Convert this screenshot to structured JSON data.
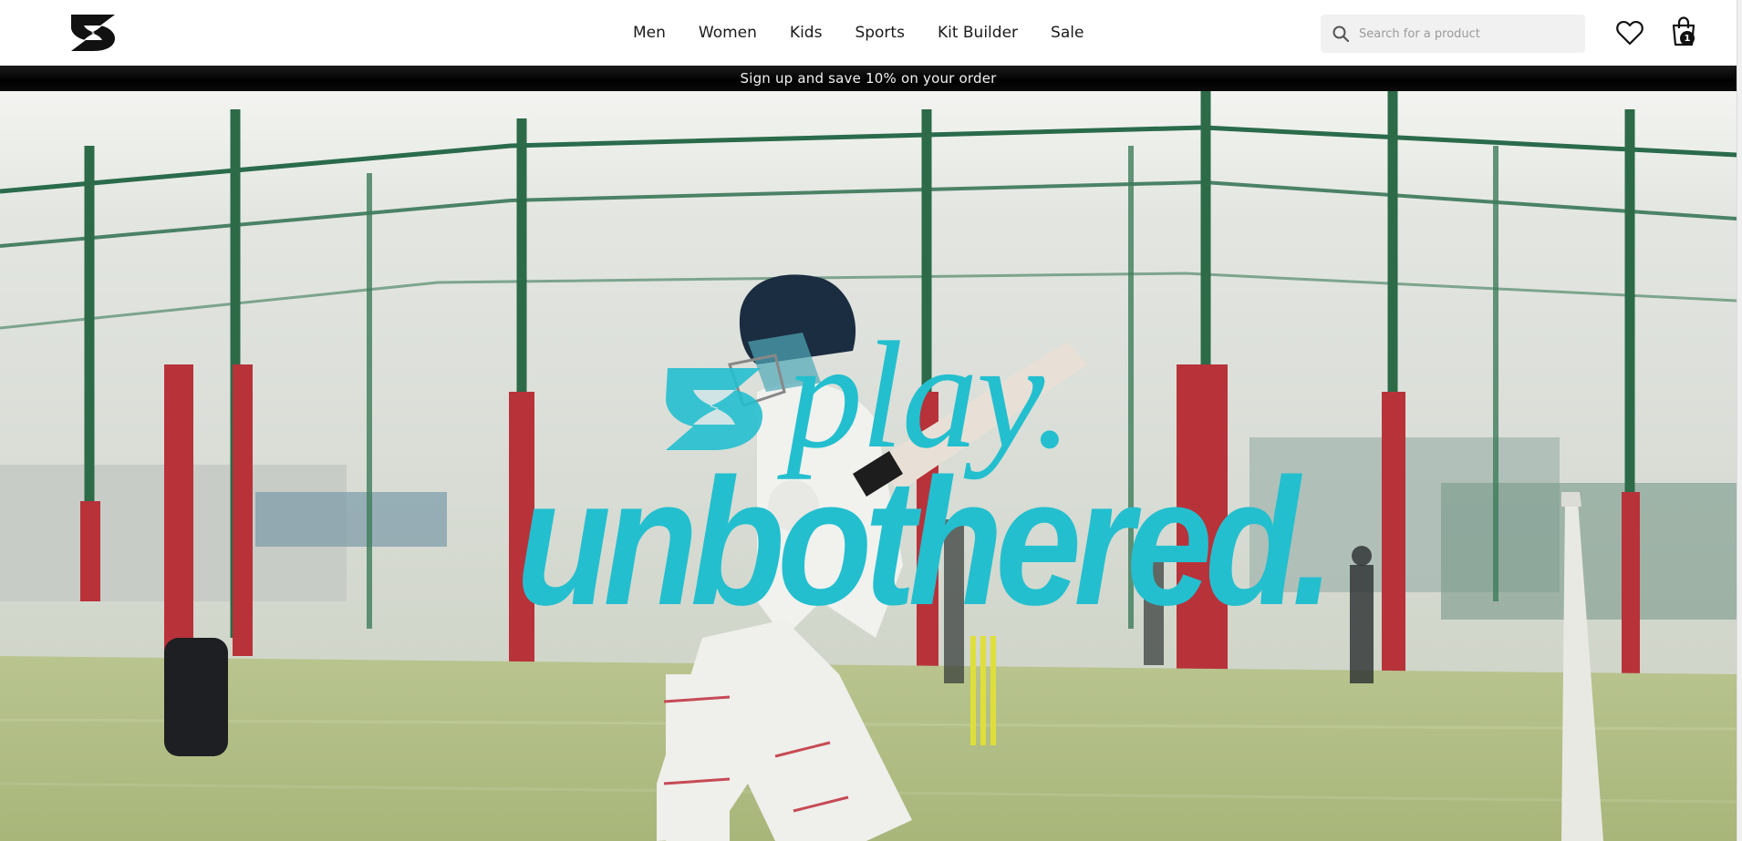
{
  "header": {
    "logo_name": "brand-logo",
    "nav": [
      {
        "label": "Men"
      },
      {
        "label": "Women"
      },
      {
        "label": "Kids"
      },
      {
        "label": "Sports"
      },
      {
        "label": "Kit Builder"
      },
      {
        "label": "Sale"
      }
    ],
    "search": {
      "placeholder": "Search for a product",
      "value": ""
    },
    "cart_count": "1"
  },
  "promo": {
    "text": "Sign up and save 10% on your order"
  },
  "hero": {
    "headline_line1": "play.",
    "headline_line2": "unbothered.",
    "accent_color": "#23bfcf"
  },
  "icons": [
    "brand-logo",
    "search-icon",
    "heart-icon",
    "shopping-bag-icon"
  ]
}
